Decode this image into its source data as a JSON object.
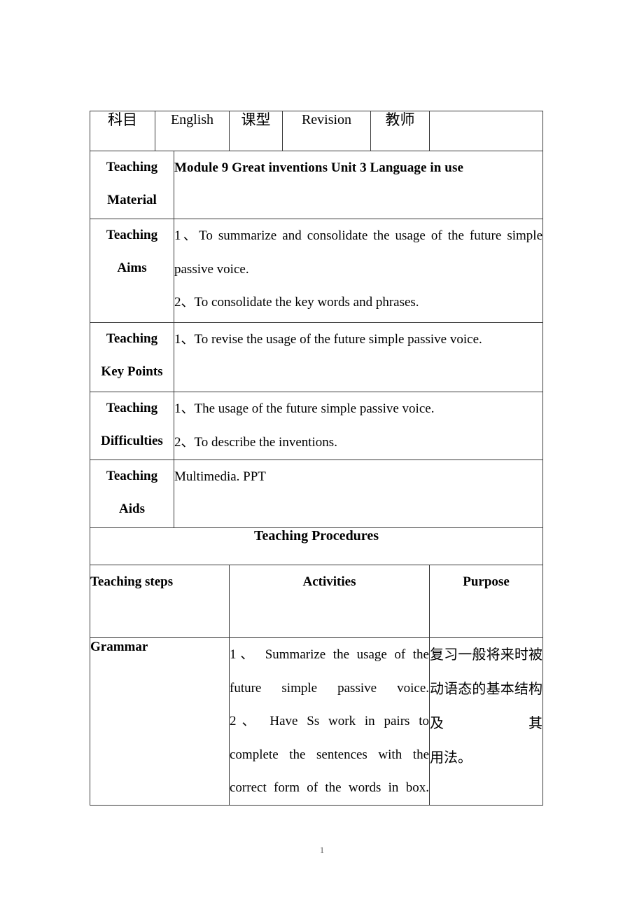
{
  "document": {
    "page_number": "1"
  },
  "info_row": {
    "subject_label": "科目",
    "subject_value": "English",
    "lesson_type_label": "课型",
    "lesson_type_value": "Revision",
    "teacher_label": "教师",
    "teacher_value": ""
  },
  "rows": {
    "teaching_material": {
      "label_line1": "Teaching",
      "label_line2": "Material",
      "content": "Module 9 Great inventions      Unit 3 Language in use"
    },
    "teaching_aims": {
      "label_line1": "Teaching",
      "label_line2": "Aims",
      "items": [
        "1、To summarize and consolidate the usage of the future simple passive voice.",
        "2、To consolidate the key words and phrases."
      ]
    },
    "teaching_key_points": {
      "label_line1": "Teaching",
      "label_line2": "Key Points",
      "items": [
        "1、To revise the usage of the future simple passive voice."
      ]
    },
    "teaching_difficulties": {
      "label_line1": "Teaching",
      "label_line2": "Difficulties",
      "items": [
        "1、The usage of the future simple passive voice.",
        "2、To describe the inventions."
      ]
    },
    "teaching_aids": {
      "label_line1": "Teaching",
      "label_line2": "Aids",
      "content": "Multimedia. PPT"
    }
  },
  "procedures": {
    "banner": "Teaching Procedures",
    "headers": {
      "steps_line1": "Teaching",
      "steps_line2": "steps",
      "activities": "Activities",
      "purpose": "Purpose"
    },
    "body_rows": [
      {
        "step": "Grammar",
        "activities": [
          "1、    Summarize the usage of the future simple passive voice.",
          "2、    Have Ss work in pairs to complete the sentences with the correct form of the words in box."
        ],
        "purpose_lines": [
          "复习一般将来时被动语态的基本结构及其",
          "用法。"
        ]
      }
    ]
  }
}
